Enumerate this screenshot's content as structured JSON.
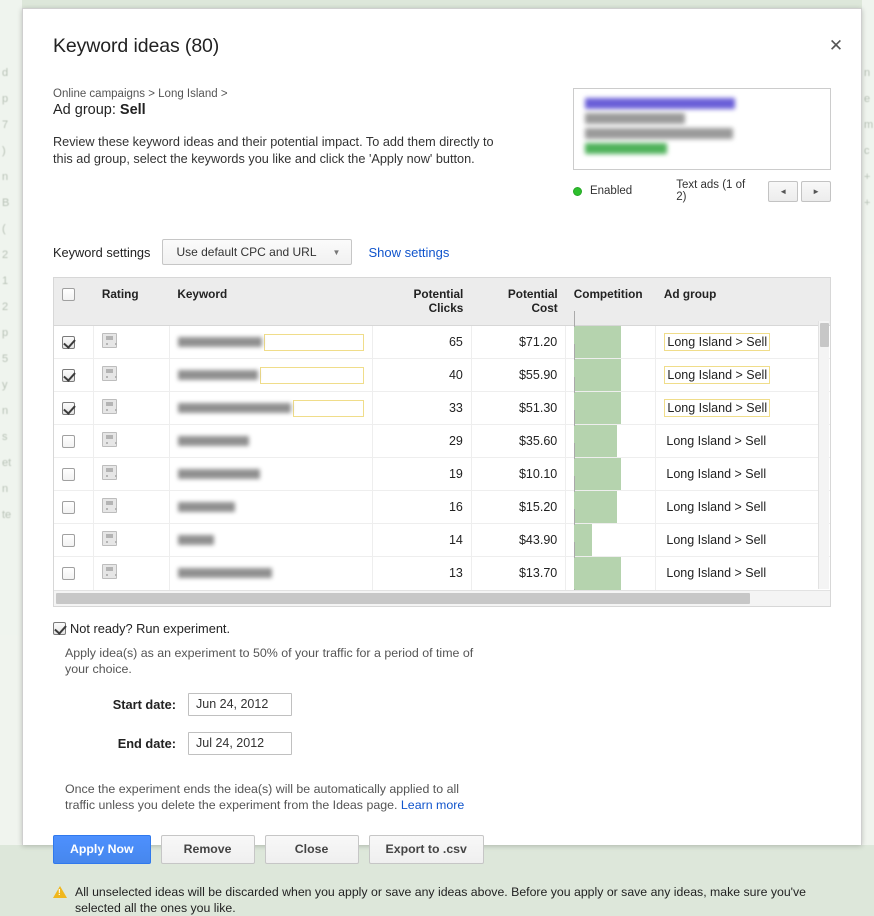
{
  "background": {
    "color": "#dde7da",
    "left_fragments": [
      "d",
      "p",
      "7",
      ")",
      "n",
      "B",
      "(",
      "2",
      "1",
      "2",
      "p",
      "5",
      "y",
      "n",
      "s",
      "et",
      "n",
      "te"
    ],
    "right_fragments": [
      "n",
      "e",
      "m",
      "c",
      "+",
      "+"
    ]
  },
  "dialog": {
    "title": "Keyword ideas (80)",
    "close_label": "✕",
    "breadcrumb": "Online campaigns > Long Island >",
    "adgroup_prefix": "Ad group:",
    "adgroup_name": "Sell",
    "intro": "Review these keyword ideas and their potential impact. To add them directly to this ad group, select the keywords you like and click the 'Apply now' button."
  },
  "ad_preview": {
    "status_label": "Enabled",
    "count_label": "Text ads (1 of 2)",
    "prev_label": "◄",
    "next_label": "►",
    "status_color": "#2ebf2e"
  },
  "keyword_settings": {
    "label": "Keyword settings",
    "select_value": "Use default CPC and URL",
    "caret": "▼",
    "show_settings_link": "Show settings"
  },
  "table": {
    "columns": [
      {
        "key": "check",
        "label": ""
      },
      {
        "key": "rating",
        "label": "Rating"
      },
      {
        "key": "keyword",
        "label": "Keyword"
      },
      {
        "key": "clicks",
        "label": "Potential Clicks"
      },
      {
        "key": "cost",
        "label": "Potential Cost"
      },
      {
        "key": "competition",
        "label": "Competition"
      },
      {
        "key": "adgroup",
        "label": "Ad group"
      }
    ],
    "rows": [
      {
        "checked": true,
        "keyword_width": 84,
        "editable": true,
        "clicks": "65",
        "cost": "$71.20",
        "competition": 64,
        "adgroup": "Long Island > Sell"
      },
      {
        "checked": true,
        "keyword_width": 80,
        "editable": true,
        "clicks": "40",
        "cost": "$55.90",
        "competition": 64,
        "adgroup": "Long Island > Sell"
      },
      {
        "checked": true,
        "keyword_width": 113,
        "editable": true,
        "clicks": "33",
        "cost": "$51.30",
        "competition": 64,
        "adgroup": "Long Island > Sell"
      },
      {
        "checked": false,
        "keyword_width": 71,
        "editable": false,
        "clicks": "29",
        "cost": "$35.60",
        "competition": 58,
        "adgroup": "Long Island > Sell"
      },
      {
        "checked": false,
        "keyword_width": 82,
        "editable": false,
        "clicks": "19",
        "cost": "$10.10",
        "competition": 64,
        "adgroup": "Long Island > Sell"
      },
      {
        "checked": false,
        "keyword_width": 57,
        "editable": false,
        "clicks": "16",
        "cost": "$15.20",
        "competition": 58,
        "adgroup": "Long Island > Sell"
      },
      {
        "checked": false,
        "keyword_width": 36,
        "editable": false,
        "clicks": "14",
        "cost": "$43.90",
        "competition": 24,
        "adgroup": "Long Island > Sell"
      },
      {
        "checked": false,
        "keyword_width": 94,
        "editable": false,
        "clicks": "13",
        "cost": "$13.70",
        "competition": 64,
        "adgroup": "Long Island > Sell"
      }
    ]
  },
  "experiment": {
    "checkbox_checked": true,
    "checkbox_label": "Not ready? Run experiment.",
    "description": "Apply idea(s) as an experiment to 50% of your traffic for a period of time of your choice.",
    "start_date_label": "Start date:",
    "start_date_value": "Jun 24, 2012",
    "end_date_label": "End date:",
    "end_date_value": "Jul 24, 2012",
    "note": "Once the experiment ends the idea(s) will be automatically applied to all traffic unless you delete the experiment from the Ideas page.",
    "note_link": "Learn more"
  },
  "buttons": {
    "apply": "Apply Now",
    "remove": "Remove",
    "close": "Close",
    "export": "Export to .csv",
    "primary_color": "#4d90fe"
  },
  "warning": {
    "text": "All unselected ideas will be discarded when you apply or save any ideas above. Before you apply or save any ideas, make sure you've selected all the ones you like.",
    "icon_color": "#f0b71d"
  }
}
